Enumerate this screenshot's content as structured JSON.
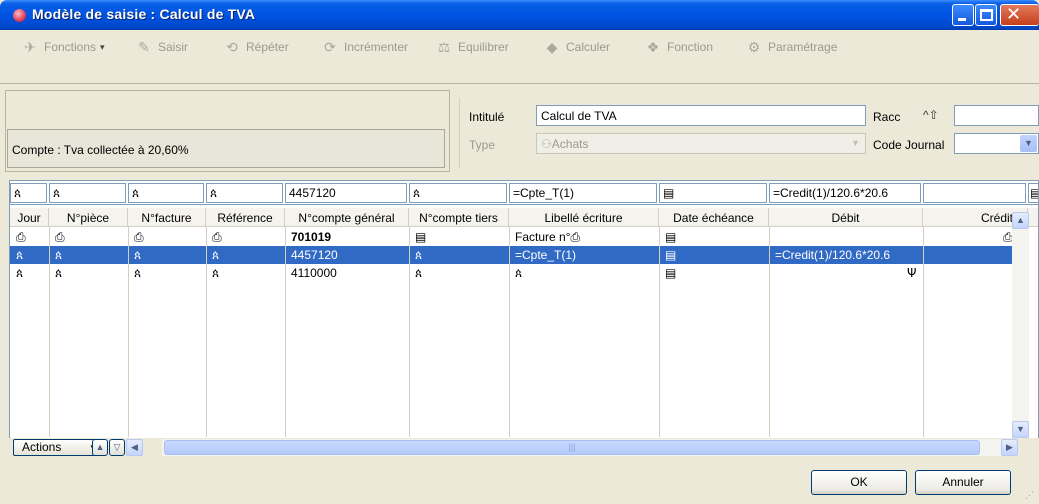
{
  "window": {
    "title": "Modèle de saisie : Calcul de TVA"
  },
  "toolbar": {
    "items": [
      {
        "label": "Fonctions",
        "icon": "functions-icon"
      },
      {
        "label": "Saisir",
        "icon": "pencil-icon"
      },
      {
        "label": "Répéter",
        "icon": "repeat-icon"
      },
      {
        "label": "Incrémenter",
        "icon": "increment-icon"
      },
      {
        "label": "Equilibrer",
        "icon": "balance-icon"
      },
      {
        "label": "Calculer",
        "icon": "calculate-icon"
      },
      {
        "label": "Fonction",
        "icon": "function-icon"
      },
      {
        "label": "Paramétrage",
        "icon": "settings-icon"
      }
    ]
  },
  "form": {
    "compte": "Compte : Tva collectée à 20,60%",
    "intitule_label": "Intitulé",
    "intitule_value": "Calcul de TVA",
    "racc_label": "Racc",
    "racc_icon_text": "^⇧",
    "racc_value": "",
    "type_label": "Type",
    "type_value": "Achats",
    "code_journal_label": "Code Journal",
    "code_journal_value": ""
  },
  "edit_row": [
    "",
    "",
    "",
    "",
    "4457120",
    "",
    "=Cpte_T(1)",
    "",
    "=Credit(1)/120.6*20.6",
    ""
  ],
  "columns": [
    "Jour",
    "N°pièce",
    "N°facture",
    "Référence",
    "N°compte général",
    "N°compte tiers",
    "Libellé écriture",
    "Date échéance",
    "Débit",
    "Crédit"
  ],
  "rows": [
    {
      "compte_general": "701019",
      "libelle": "Facture n°",
      "debit": ""
    },
    {
      "compte_general": "4457120",
      "libelle": "=Cpte_T(1)",
      "debit": "=Credit(1)/120.6*20.6"
    },
    {
      "compte_general": "4110000",
      "libelle": "",
      "debit": ""
    }
  ],
  "footer": {
    "actions_label": "Actions",
    "ok_label": "OK",
    "cancel_label": "Annuler"
  }
}
